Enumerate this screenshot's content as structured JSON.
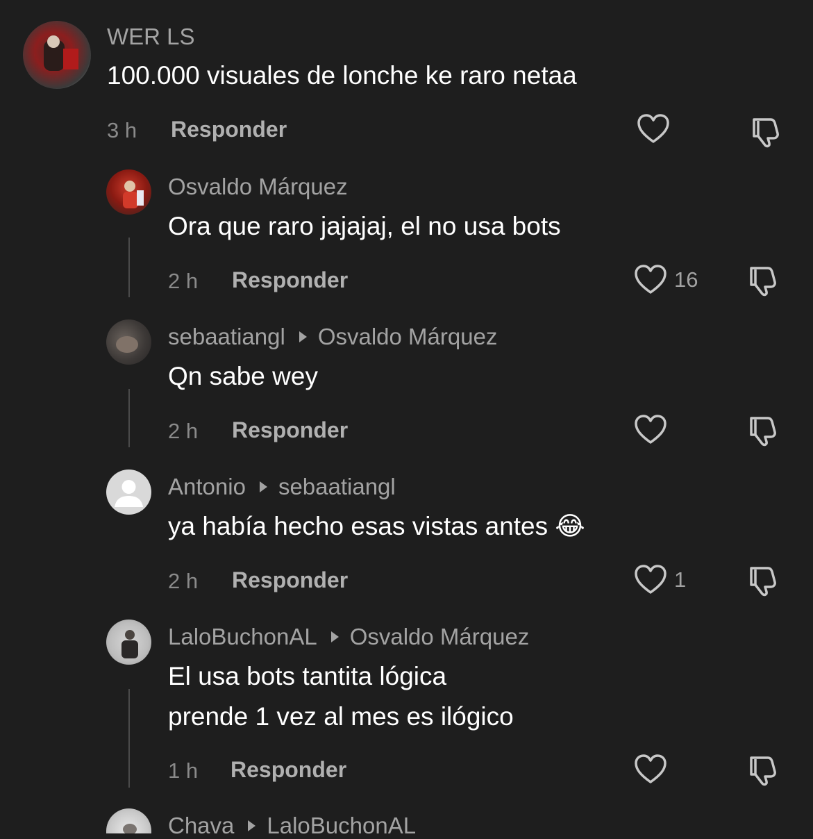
{
  "comments": [
    {
      "username": "WER LS",
      "reply_to": "",
      "lines": [
        "100.000 visuales de lonche ke raro netaa"
      ],
      "time": "3 h",
      "reply_label": "Responder",
      "likes": "",
      "avatar": "photo-avatar-red"
    },
    {
      "username": "Osvaldo Márquez",
      "reply_to": "",
      "lines": [
        "Ora que raro jajajaj, el no usa bots"
      ],
      "time": "2 h",
      "reply_label": "Responder",
      "likes": "16",
      "avatar": "photo-avatar-singer"
    },
    {
      "username": "sebaatiangl",
      "reply_to": "Osvaldo Márquez",
      "lines": [
        "Qn sabe wey"
      ],
      "time": "2 h",
      "reply_label": "Responder",
      "likes": "",
      "avatar": "photo-avatar-dark"
    },
    {
      "username": "Antonio",
      "reply_to": "sebaatiangl",
      "lines": [
        "ya había hecho esas vistas antes 😂"
      ],
      "time": "2 h",
      "reply_label": "Responder",
      "likes": "1",
      "avatar": "default-avatar"
    },
    {
      "username": "LaloBuchonAL",
      "reply_to": "Osvaldo Márquez",
      "lines": [
        "El usa bots tantita lógica",
        "prende 1 vez al mes es ilógico"
      ],
      "time": "1 h",
      "reply_label": "Responder",
      "likes": "",
      "avatar": "photo-avatar-mirror"
    },
    {
      "username": "Chava",
      "reply_to": "LaloBuchonAL",
      "lines": [],
      "time": "",
      "reply_label": "",
      "likes": "",
      "avatar": "photo-avatar-light"
    }
  ],
  "colors": {
    "background": "#1e1e1e",
    "username": "#a3a3a3",
    "text": "#ffffff",
    "meta": "#8a8a8a",
    "icon": "#c8c8c8"
  }
}
